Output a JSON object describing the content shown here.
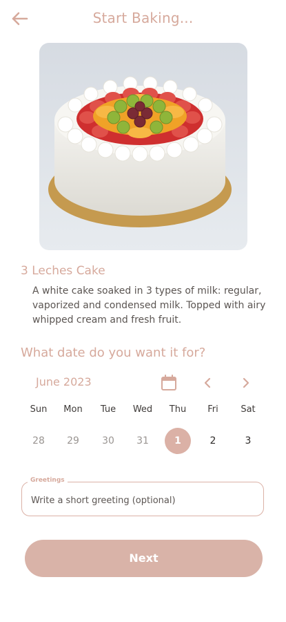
{
  "header": {
    "title": "Start Baking..."
  },
  "product": {
    "name": "3 Leches Cake",
    "description": "A white cake soaked in 3 types of milk: regular, vaporized and condensed milk. Topped with airy whipped cream and fresh fruit."
  },
  "date_section": {
    "question": "What date do you want it for?",
    "calendar": {
      "month": "June 2023",
      "weekdays": [
        "Sun",
        "Mon",
        "Tue",
        "Wed",
        "Thu",
        "Fri",
        "Sat"
      ],
      "days": [
        "28",
        "29",
        "30",
        "31",
        "1",
        "2",
        "3"
      ],
      "selected_day": "1"
    }
  },
  "greeting": {
    "label": "Greetings",
    "placeholder": "Write a short greeting (optional)",
    "value": ""
  },
  "actions": {
    "next_label": "Next"
  },
  "colors": {
    "accent": "#d6a99c",
    "button": "#d9b3a8",
    "text": "#5b5552"
  },
  "icons": {
    "back": "arrow-left-icon",
    "calendar": "calendar-icon",
    "prev": "chevron-left-icon",
    "next": "chevron-right-icon"
  }
}
